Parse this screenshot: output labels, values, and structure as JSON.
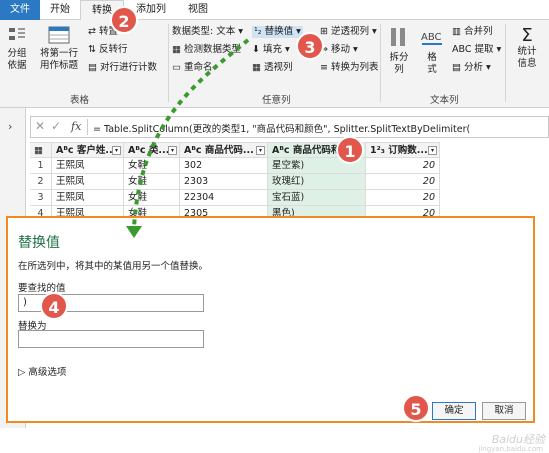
{
  "tabs": [
    "文件",
    "开始",
    "转换",
    "添加列",
    "视图"
  ],
  "ribbon": {
    "group_table": {
      "label": "表格",
      "group_by": "分组\n依据",
      "first_row_header": "将第一行\n用作标题",
      "transpose": "转置",
      "reverse_rows": "反转行",
      "count_rows": "对行进行计数"
    },
    "group_any": {
      "label": "任意列",
      "data_type": "数据类型: 文本",
      "detect_type": "检测数据类型",
      "rename": "重命名",
      "replace_values": "替换值",
      "fill": "填充",
      "pivot": "透视列",
      "unpivot": "逆透视列",
      "move": "移动",
      "to_list": "转换为列表"
    },
    "group_text": {
      "label": "文本列",
      "split": "拆分\n列",
      "format": "格\n式",
      "merge": "合并列",
      "extract": "提取",
      "parse": "分析"
    },
    "group_number": {
      "stats": "统计\n信息"
    }
  },
  "formula": {
    "text": "= Table.SplitColumn(更改的类型1, \"商品代码和颜色\", Splitter.SplitTextByDelimiter("
  },
  "left_panel": {
    "label": "查询"
  },
  "grid": {
    "headers": [
      "客户姓...",
      "类...",
      "商品代码...",
      "商品代码和...",
      "订购数..."
    ],
    "rows": [
      {
        "n": "1",
        "name": "王熙凤",
        "cat": "女鞋",
        "code": "302",
        "color": "星空紫)",
        "qty": "20"
      },
      {
        "n": "2",
        "name": "王熙凤",
        "cat": "女鞋",
        "code": "2303",
        "color": "玫瑰红)",
        "qty": "20"
      },
      {
        "n": "3",
        "name": "王熙凤",
        "cat": "女鞋",
        "code": "22304",
        "color": "宝石蓝)",
        "qty": "20"
      },
      {
        "n": "4",
        "name": "王熙凤",
        "cat": "女鞋",
        "code": "2305",
        "color": "黑色)",
        "qty": "20"
      }
    ]
  },
  "dialog": {
    "title": "替换值",
    "description": "在所选列中，将其中的某值用另一个值替换。",
    "find_label": "要查找的值",
    "find_value": ")",
    "replace_label": "替换为",
    "replace_value": "",
    "advanced": "高级选项",
    "ok": "确定",
    "cancel": "取消"
  },
  "badges": [
    "1",
    "2",
    "3",
    "4",
    "5"
  ],
  "watermark": {
    "brand": "Baidu经验",
    "url": "jingyan.baidu.com"
  },
  "colors": {
    "accent_green": "#217346",
    "badge_red": "#e2574c",
    "dialog_border": "#f08a24",
    "arrow_green": "#3a9a2e"
  }
}
